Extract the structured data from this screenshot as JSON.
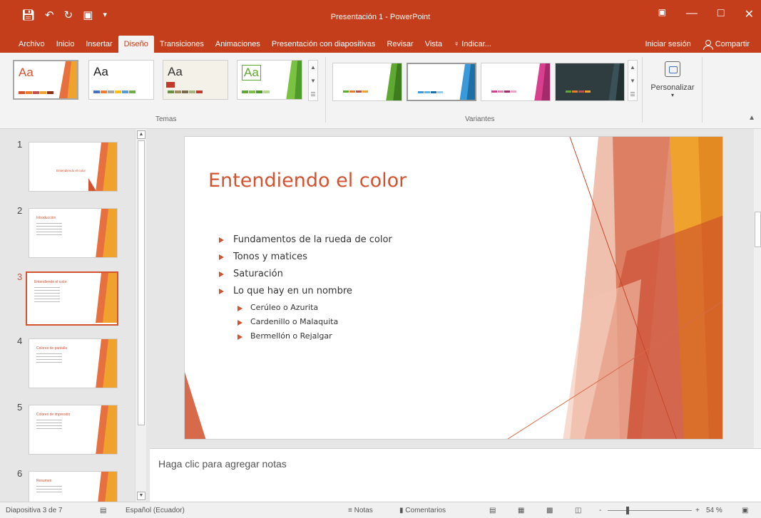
{
  "window": {
    "title": "Presentación 1 - PowerPoint",
    "qat_icons": [
      "save-icon",
      "undo-icon",
      "redo-icon",
      "start-presentation-icon",
      "customize-qat-icon"
    ],
    "controls": [
      "ribbon-display-icon",
      "minimize-icon",
      "maximize-icon",
      "close-icon"
    ]
  },
  "menu": {
    "tabs": [
      "Archivo",
      "Inicio",
      "Insertar",
      "Diseño",
      "Transiciones",
      "Animaciones",
      "Presentación con diapositivas",
      "Revisar",
      "Vista",
      "♀ Indicar..."
    ],
    "active": "Diseño",
    "signin": "Iniciar sesión",
    "share": "Compartir"
  },
  "ribbon": {
    "themes_label": "Temas",
    "variants_label": "Variantes",
    "customize_label": "Personalizar",
    "theme_samples": [
      "Aa",
      "Aa",
      "Aa",
      "Aa"
    ]
  },
  "thumbnails": [
    {
      "num": "1",
      "title": "Entendiendo el color"
    },
    {
      "num": "2",
      "title": "Introducción"
    },
    {
      "num": "3",
      "title": "Entendiendo el color"
    },
    {
      "num": "4",
      "title": "Colores de pantalla"
    },
    {
      "num": "5",
      "title": "Colores de impresión"
    },
    {
      "num": "6",
      "title": "Resumen"
    }
  ],
  "slide": {
    "title": "Entendiendo el color",
    "bullets": [
      "Fundamentos de la rueda de color",
      "Tonos y matices",
      "Saturación",
      "Lo que hay en un nombre"
    ],
    "subbullets": [
      "Cerúleo o Azurita",
      "Cardenillo o Malaquita",
      "Bermellón o Rejalgar"
    ]
  },
  "notes": {
    "placeholder": "Haga clic para agregar notas"
  },
  "status": {
    "slide_info": "Diapositiva 3 de 7",
    "language": "Español (Ecuador)",
    "notes": "Notas",
    "comments": "Comentarios",
    "zoom": "54 %",
    "zoom_minus": "-",
    "zoom_plus": "+"
  },
  "colors": {
    "accent": "#c43e1c",
    "title": "#d35230",
    "orange": "#f0a22e"
  }
}
